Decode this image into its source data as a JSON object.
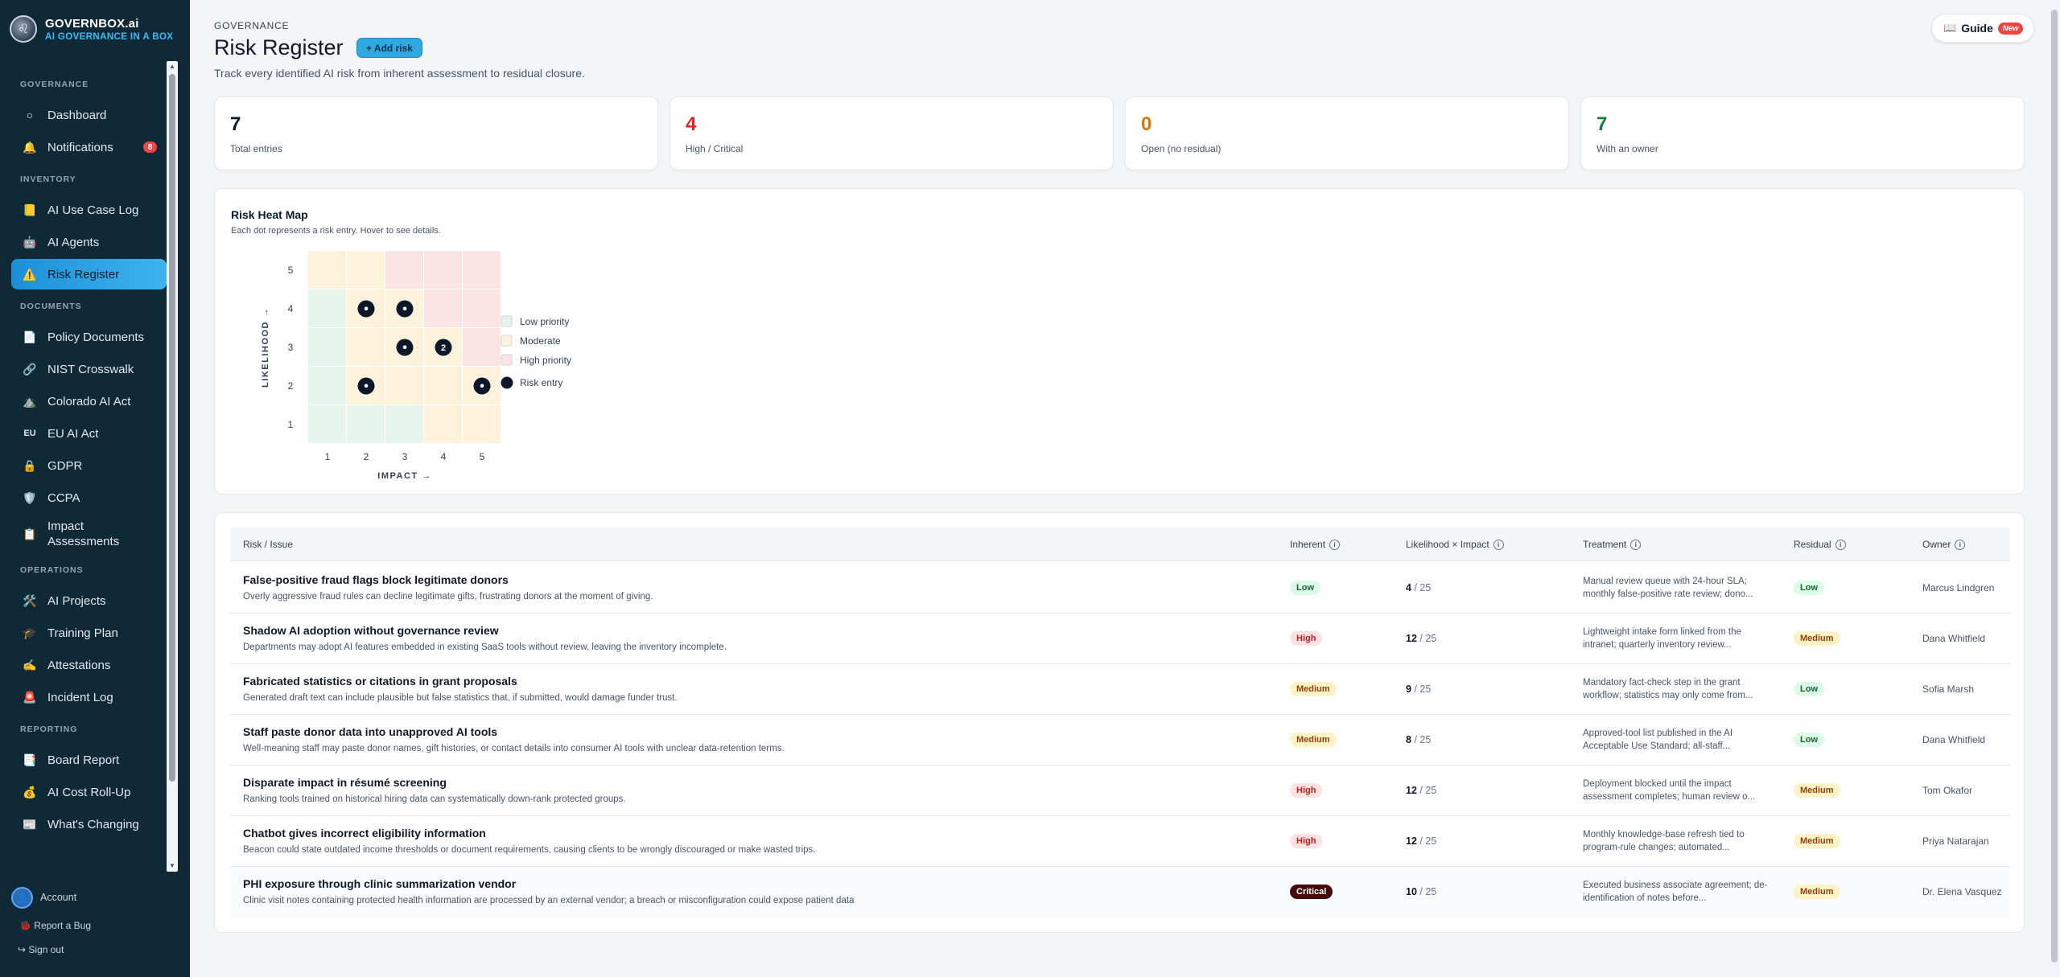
{
  "brand": {
    "name": "GOVERNBOX.ai",
    "tagline": "AI GOVERNANCE IN A BOX"
  },
  "sidebar": {
    "sections": [
      {
        "title": "GOVERNANCE",
        "items": [
          {
            "label": "Dashboard",
            "icon": "circle-icon"
          },
          {
            "label": "Notifications",
            "icon": "bell-icon",
            "badge": "8"
          }
        ]
      },
      {
        "title": "INVENTORY",
        "items": [
          {
            "label": "AI Use Case Log",
            "icon": "folder-icon"
          },
          {
            "label": "AI Agents",
            "icon": "robot-icon"
          },
          {
            "label": "Risk Register",
            "icon": "warning-icon",
            "active": true
          }
        ]
      },
      {
        "title": "DOCUMENTS",
        "items": [
          {
            "label": "Policy Documents",
            "icon": "document-icon"
          },
          {
            "label": "NIST Crosswalk",
            "icon": "link-icon"
          },
          {
            "label": "Colorado AI Act",
            "icon": "mountain-icon"
          },
          {
            "label": "EU AI Act",
            "icon": "eu-icon"
          },
          {
            "label": "GDPR",
            "icon": "lock-icon"
          },
          {
            "label": "CCPA",
            "icon": "shield-icon"
          },
          {
            "label": "Impact Assessments",
            "icon": "clipboard-icon"
          }
        ]
      },
      {
        "title": "OPERATIONS",
        "items": [
          {
            "label": "AI Projects",
            "icon": "tools-icon"
          },
          {
            "label": "Training Plan",
            "icon": "graduation-icon"
          },
          {
            "label": "Attestations",
            "icon": "signature-icon"
          },
          {
            "label": "Incident Log",
            "icon": "siren-icon"
          }
        ]
      },
      {
        "title": "REPORTING",
        "items": [
          {
            "label": "Board Report",
            "icon": "report-icon"
          },
          {
            "label": "AI Cost Roll-Up",
            "icon": "money-bag-icon"
          },
          {
            "label": "What's Changing",
            "icon": "news-icon"
          }
        ]
      }
    ],
    "footer": {
      "account": "Account",
      "report_bug": "Report a Bug",
      "sign_out": "Sign out"
    }
  },
  "header": {
    "breadcrumb": "GOVERNANCE",
    "title": "Risk Register",
    "add_button": "+ Add risk",
    "subtitle": "Track every identified AI risk from inherent assessment to residual closure.",
    "guide_label": "Guide",
    "guide_badge": "New"
  },
  "stats": [
    {
      "value": "7",
      "label": "Total entries",
      "color": "#0f172a"
    },
    {
      "value": "4",
      "label": "High / Critical",
      "color": "#dc2626"
    },
    {
      "value": "0",
      "label": "Open (no residual)",
      "color": "#d97706"
    },
    {
      "value": "7",
      "label": "With an owner",
      "color": "#15803d"
    }
  ],
  "heatmap": {
    "title": "Risk Heat Map",
    "subtitle": "Each dot represents a risk entry. Hover to see details.",
    "y_label": "LIKELIHOOD →",
    "x_label": "IMPACT →",
    "ticks": [
      "1",
      "2",
      "3",
      "4",
      "5"
    ],
    "legend": [
      "Low priority",
      "Moderate",
      "High priority",
      "Risk entry"
    ],
    "colors": {
      "low": "#e6f4ec",
      "moderate": "#fdf3dc",
      "high": "#fde4e4",
      "dot": "#0f172a"
    },
    "cells": [
      [
        "low",
        "low",
        "low",
        "moderate",
        "moderate"
      ],
      [
        "low",
        "moderate",
        "moderate",
        "moderate",
        "moderate"
      ],
      [
        "low",
        "moderate",
        "moderate",
        "moderate",
        "high"
      ],
      [
        "low",
        "moderate",
        "moderate",
        "high",
        "high"
      ],
      [
        "moderate",
        "moderate",
        "high",
        "high",
        "high"
      ]
    ],
    "entries": [
      {
        "likelihood": 4,
        "impact": 2,
        "count": "•"
      },
      {
        "likelihood": 4,
        "impact": 3,
        "count": "•"
      },
      {
        "likelihood": 3,
        "impact": 3,
        "count": "•"
      },
      {
        "likelihood": 3,
        "impact": 4,
        "count": "2"
      },
      {
        "likelihood": 2,
        "impact": 2,
        "count": "•"
      },
      {
        "likelihood": 2,
        "impact": 5,
        "count": "•"
      }
    ]
  },
  "table": {
    "columns": [
      "Risk / Issue",
      "Inherent",
      "Likelihood × Impact",
      "Treatment",
      "Residual",
      "Owner"
    ],
    "rows": [
      {
        "title": "False-positive fraud flags block legitimate donors",
        "desc": "Overly aggressive fraud rules can decline legitimate gifts, frustrating donors at the moment of giving.",
        "inherent": "Low",
        "score": "4",
        "max": "/ 25",
        "treatment": "Manual review queue with 24-hour SLA; monthly false-positive rate review; dono...",
        "residual": "Low",
        "owner": "Marcus Lindgren"
      },
      {
        "title": "Shadow AI adoption without governance review",
        "desc": "Departments may adopt AI features embedded in existing SaaS tools without review, leaving the inventory incomplete.",
        "inherent": "High",
        "score": "12",
        "max": "/ 25",
        "treatment": "Lightweight intake form linked from the intranet; quarterly inventory review...",
        "residual": "Medium",
        "owner": "Dana Whitfield"
      },
      {
        "title": "Fabricated statistics or citations in grant proposals",
        "desc": "Generated draft text can include plausible but false statistics that, if submitted, would damage funder trust.",
        "inherent": "Medium",
        "score": "9",
        "max": "/ 25",
        "treatment": "Mandatory fact-check step in the grant workflow; statistics may only come from...",
        "residual": "Low",
        "owner": "Sofia Marsh"
      },
      {
        "title": "Staff paste donor data into unapproved AI tools",
        "desc": "Well-meaning staff may paste donor names, gift histories, or contact details into consumer AI tools with unclear data-retention terms.",
        "inherent": "Medium",
        "score": "8",
        "max": "/ 25",
        "treatment": "Approved-tool list published in the AI Acceptable Use Standard; all-staff...",
        "residual": "Low",
        "owner": "Dana Whitfield"
      },
      {
        "title": "Disparate impact in résumé screening",
        "desc": "Ranking tools trained on historical hiring data can systematically down-rank protected groups.",
        "inherent": "High",
        "score": "12",
        "max": "/ 25",
        "treatment": "Deployment blocked until the impact assessment completes; human review o...",
        "residual": "Medium",
        "owner": "Tom Okafor"
      },
      {
        "title": "Chatbot gives incorrect eligibility information",
        "desc": "Beacon could state outdated income thresholds or document requirements, causing clients to be wrongly discouraged or make wasted trips.",
        "inherent": "High",
        "score": "12",
        "max": "/ 25",
        "treatment": "Monthly knowledge-base refresh tied to program-rule changes; automated...",
        "residual": "Medium",
        "owner": "Priya Natarajan"
      },
      {
        "title": "PHI exposure through clinic summarization vendor",
        "desc": "Clinic visit notes containing protected health information are processed by an external vendor; a breach or misconfiguration could expose patient data",
        "inherent": "Critical",
        "score": "10",
        "max": "/ 25",
        "treatment": "Executed business associate agreement; de-identification of notes before...",
        "residual": "Medium",
        "owner": "Dr. Elena Vasquez"
      }
    ]
  }
}
